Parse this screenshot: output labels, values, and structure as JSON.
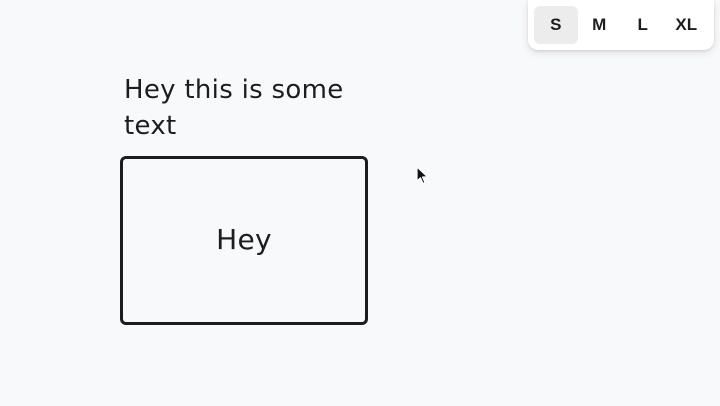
{
  "size_toolbar": {
    "options": [
      {
        "label": "S",
        "selected": true
      },
      {
        "label": "M",
        "selected": false
      },
      {
        "label": "L",
        "selected": false
      },
      {
        "label": "XL",
        "selected": false
      }
    ]
  },
  "canvas": {
    "text_shape": {
      "text": "Hey this is some text"
    },
    "rectangle_shape": {
      "label": "Hey"
    }
  },
  "colors": {
    "background": "#f8f9fa",
    "stroke": "#1d1d1d",
    "toolbar_bg": "#ffffff",
    "selected_bg": "#ececec"
  },
  "icons": {
    "cursor": "mouse-pointer-icon"
  }
}
